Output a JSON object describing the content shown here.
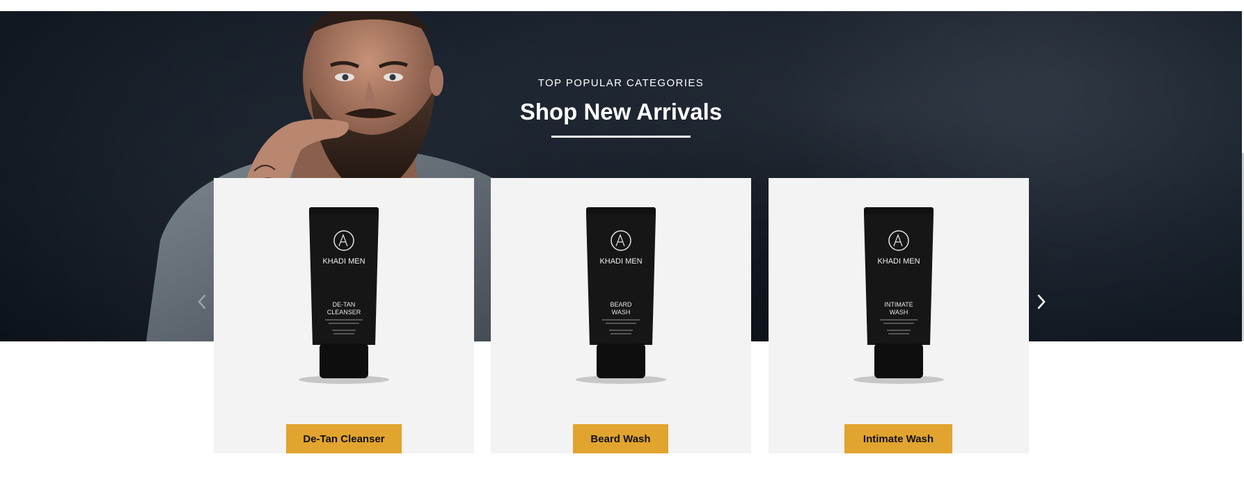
{
  "hero": {
    "kicker": "TOP POPULAR CATEGORIES",
    "headline": "Shop New Arrivals"
  },
  "carousel": {
    "prev_icon": "chevron-left-icon",
    "next_icon": "chevron-right-icon"
  },
  "products": [
    {
      "name": "De-Tan Cleanser",
      "brand": "KHADI MEN",
      "tube_label_line1": "DE-TAN",
      "tube_label_line2": "CLEANSER",
      "button_label": "De-Tan Cleanser"
    },
    {
      "name": "Beard Wash",
      "brand": "KHADI MEN",
      "tube_label_line1": "BEARD",
      "tube_label_line2": "WASH",
      "button_label": "Beard Wash"
    },
    {
      "name": "Intimate Wash",
      "brand": "KHADI MEN",
      "tube_label_line1": "INTIMATE",
      "tube_label_line2": "WASH",
      "button_label": "Intimate Wash"
    }
  ],
  "colors": {
    "accent_button": "#e1a42f",
    "hero_dark": "#0b1119",
    "card_bg": "#f3f3f3"
  }
}
